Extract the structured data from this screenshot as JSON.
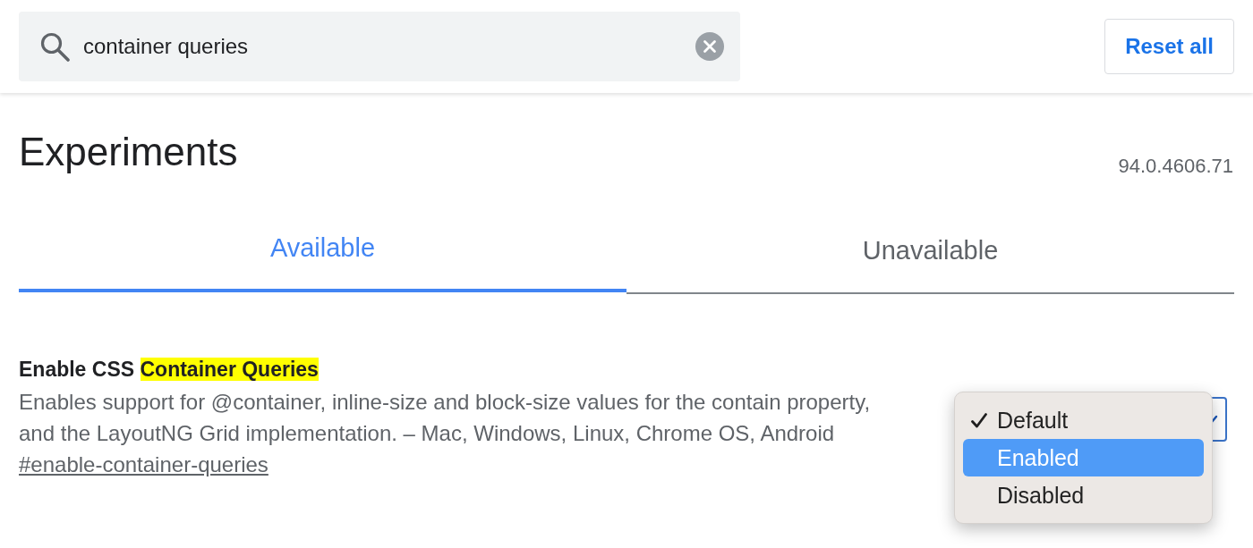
{
  "search": {
    "value": "container queries"
  },
  "reset_button": {
    "label": "Reset all"
  },
  "page": {
    "title": "Experiments",
    "version": "94.0.4606.71"
  },
  "tabs": [
    {
      "label": "Available",
      "selected": true
    },
    {
      "label": "Unavailable",
      "selected": false
    }
  ],
  "experiments": [
    {
      "title_parts": [
        {
          "text": "Enable CSS",
          "highlighted": false
        },
        {
          "text": "Container Queries",
          "highlighted": true
        }
      ],
      "description": "Enables support for @container, inline-size and block-size values for the contain property, and the LayoutNG Grid implementation. – Mac, Windows, Linux, Chrome OS, Android",
      "link": "#enable-container-queries",
      "dropdown": {
        "expanded": true,
        "options": [
          {
            "label": "Default",
            "selected": true,
            "highlighted": false
          },
          {
            "label": "Enabled",
            "selected": false,
            "highlighted": true
          },
          {
            "label": "Disabled",
            "selected": false,
            "highlighted": false
          }
        ]
      }
    }
  ]
}
